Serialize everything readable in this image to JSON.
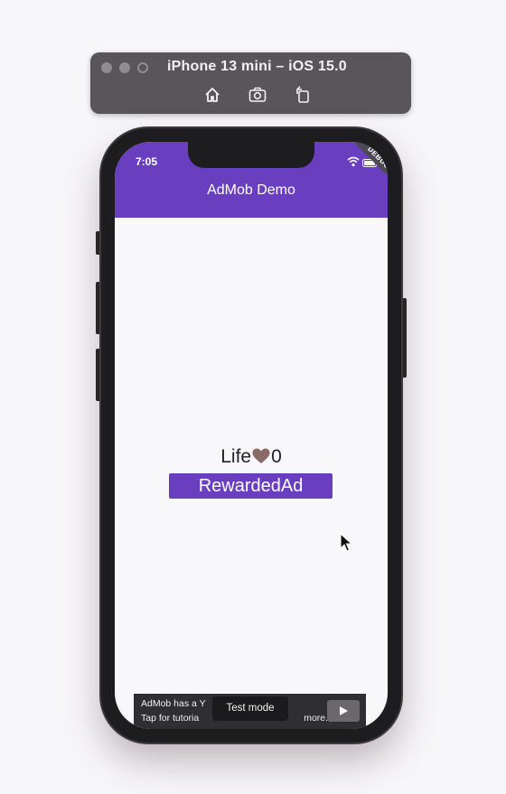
{
  "simulator": {
    "title": "iPhone 13 mini – iOS 15.0",
    "tools": [
      "home-icon",
      "screenshot-icon",
      "rotate-icon"
    ]
  },
  "status_bar": {
    "time": "7:05",
    "debug_label": "DEBUG"
  },
  "app_bar": {
    "title": "AdMob Demo",
    "color": "#6a3fbf"
  },
  "main": {
    "life_label": "Life",
    "life_icon": "heart-icon",
    "life_count": "0",
    "rewarded_button_label": "RewardedAd"
  },
  "ad_banner": {
    "line1": "AdMob has a Y",
    "line2": "Tap for tutoria",
    "line2_tail": "more.",
    "test_mode_label": "Test mode"
  }
}
